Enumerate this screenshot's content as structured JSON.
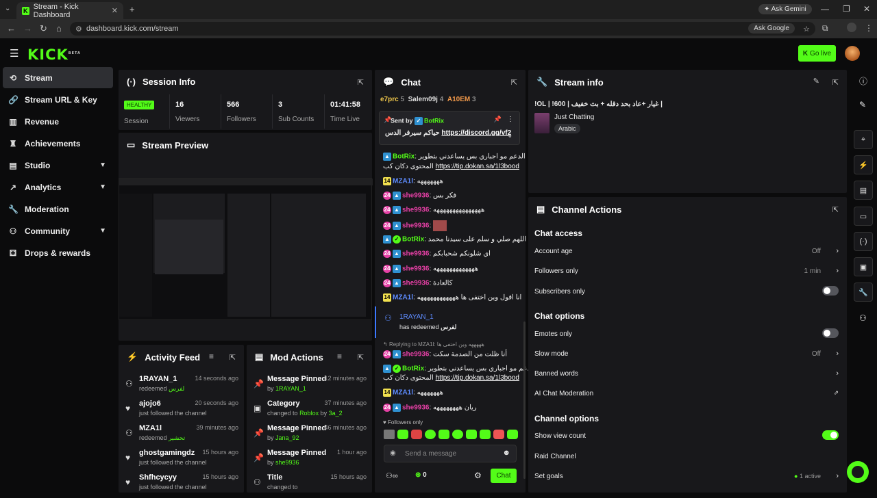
{
  "browser": {
    "tab_title": "Stream - Kick Dashboard",
    "url": "dashboard.kick.com/stream",
    "ask_gemini": "Ask Gemini",
    "ask_google": "Ask Google"
  },
  "header": {
    "logo": "KICK",
    "logo_sup": "BETA",
    "go_live": "Go live"
  },
  "sidebar": {
    "items": [
      {
        "label": "Stream",
        "icon": "stream-icon"
      },
      {
        "label": "Stream URL & Key",
        "icon": "link-icon"
      },
      {
        "label": "Revenue",
        "icon": "chart-icon"
      },
      {
        "label": "Achievements",
        "icon": "trophy-icon"
      },
      {
        "label": "Studio",
        "icon": "studio-icon"
      },
      {
        "label": "Analytics",
        "icon": "analytics-icon"
      },
      {
        "label": "Moderation",
        "icon": "wrench-icon"
      },
      {
        "label": "Community",
        "icon": "community-icon"
      },
      {
        "label": "Drops & rewards",
        "icon": "gift-icon"
      }
    ]
  },
  "session": {
    "title": "Session Info",
    "status": "HEALTHY",
    "status_label": "Session",
    "stats": [
      {
        "value": "16",
        "label": "Viewers"
      },
      {
        "value": "566",
        "label": "Followers"
      },
      {
        "value": "3",
        "label": "Sub Counts"
      },
      {
        "value": "01:41:58",
        "label": "Time Live"
      }
    ]
  },
  "preview": {
    "title": "Stream Preview"
  },
  "activity": {
    "title": "Activity Feed",
    "rows": [
      {
        "name": "1RAYAN_1",
        "sub": "redeemed",
        "extra": "لفرس",
        "time": "14 seconds ago"
      },
      {
        "name": "ajojo6",
        "sub": "just followed the channel",
        "extra": "",
        "time": "20 seconds ago"
      },
      {
        "name": "MZA1l",
        "sub": "redeemed",
        "extra": "تحشير",
        "time": "39 minutes ago"
      },
      {
        "name": "ghostgamingdz",
        "sub": "just followed the channel",
        "extra": "",
        "time": "15 hours ago"
      },
      {
        "name": "Shfhcycyy",
        "sub": "just followed the channel",
        "extra": "",
        "time": "15 hours ago"
      }
    ]
  },
  "mod": {
    "title": "Mod Actions",
    "rows": [
      {
        "name": "Message Pinned",
        "sub": "by",
        "extra": "1RAYAN_1",
        "time": "12 minutes ago"
      },
      {
        "name": "Category",
        "sub": "changed to",
        "extra": "Roblox",
        "sub2": "by",
        "extra2": "3a_2",
        "time": "37 minutes ago"
      },
      {
        "name": "Message Pinned",
        "sub": "by",
        "extra": "Jana_92",
        "time": "46 minutes ago"
      },
      {
        "name": "Message Pinned",
        "sub": "by",
        "extra": "she9936",
        "time": "1 hour ago"
      },
      {
        "name": "Title",
        "sub": "changed to",
        "extra": "",
        "time": "15 hours ago"
      }
    ]
  },
  "chat": {
    "title": "Chat",
    "top": [
      {
        "name": "e7prc",
        "n": "5"
      },
      {
        "name": "Salem09j",
        "n": "4"
      },
      {
        "name": "A10EM",
        "n": "3"
      }
    ],
    "pinned": {
      "label": "Sent by",
      "user": "BotRix",
      "text": "حياكم سيرفر الدس",
      "link": "https://discord.gg/vf2"
    },
    "msgs": [
      {
        "user": "BotRix",
        "badge": "v",
        "color": "#53fc18",
        "text": "الدعم مو اجباري بس يساعدني بتطوير",
        "text2": "المحتوى دكان كب",
        "link": "https://tip.dokan.sa/1l3bood"
      },
      {
        "user": "MZA1l",
        "badge": "y",
        "color": "#3c78ff",
        "text": "هههههههه"
      },
      {
        "user": "she9936",
        "badge": "p",
        "color": "#e540a5",
        "text": "فكر بس"
      },
      {
        "user": "she9936",
        "badge": "p",
        "color": "#e540a5",
        "text": "هههههههههههههههه"
      },
      {
        "user": "she9936",
        "badge": "p",
        "color": "#e540a5",
        "text": ""
      },
      {
        "user": "BotRix",
        "badge": "v",
        "color": "#53fc18",
        "text": "اللهم صلي و سلم على سيدنا محمد"
      },
      {
        "user": "she9936",
        "badge": "p",
        "color": "#e540a5",
        "text": "اي شلونكم شحبابكم"
      },
      {
        "user": "she9936",
        "badge": "p",
        "color": "#e540a5",
        "text": "هههههههههههههه"
      },
      {
        "user": "she9936",
        "badge": "p",
        "color": "#e540a5",
        "text": "كالعادة"
      },
      {
        "user": "MZA1l",
        "badge": "y",
        "color": "#3c78ff",
        "text": "انا اقول وين اختفى ها ههههههههههههه"
      }
    ],
    "redeem": {
      "user": "1RAYAN_1",
      "text": "has redeemed",
      "reward": "لفرس"
    },
    "reply": {
      "label": "Replying to MZA1l:",
      "quote": "هههههه وين اختفى ها",
      "user": "she9936",
      "text": "أنا ظلت من الصدمة سكت"
    },
    "msgs2": [
      {
        "user": "BotRix",
        "badge": "v",
        "color": "#53fc18",
        "text": "الدعم مو اجباري بس يساعدني بتطوير",
        "text2": "المحتوى دكان كب",
        "link": "https://tip.dokan.sa/1l3bood"
      },
      {
        "user": "MZA1l",
        "badge": "y",
        "color": "#3c78ff",
        "text": "هههههههه"
      },
      {
        "user": "she9936",
        "badge": "p",
        "color": "#e540a5",
        "text": "ريان ههههههههه"
      }
    ],
    "followers_only": "Followers only",
    "input_placeholder": "Send a message",
    "points": "0",
    "send": "Chat"
  },
  "stream_info": {
    "title": "Stream info",
    "stream_title": "!OL | !600 | غيار +عاد بحد دقله + بث خفيف |",
    "category": "Just Chatting",
    "tag": "Arabic"
  },
  "channel_actions": {
    "title": "Channel Actions",
    "chat_access": "Chat access",
    "account_age": "Account age",
    "account_age_val": "Off",
    "followers_only": "Followers only",
    "followers_only_val": "1 min",
    "subscribers_only": "Subscribers only",
    "chat_options": "Chat options",
    "emotes_only": "Emotes only",
    "slow_mode": "Slow mode",
    "slow_mode_val": "Off",
    "banned_words": "Banned words",
    "ai_mod": "AI Chat Moderation",
    "channel_options": "Channel options",
    "show_view_count": "Show view count",
    "raid_channel": "Raid Channel",
    "set_goals": "Set goals",
    "set_goals_val": "1 active"
  },
  "colors": {
    "accent": "#53fc18",
    "panel": "#18181b",
    "bg": "#0b0b0c"
  }
}
